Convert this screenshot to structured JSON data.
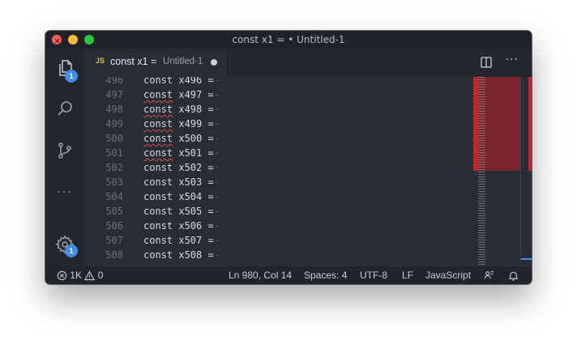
{
  "window": {
    "title": "const x1 = • Untitled-1"
  },
  "activity_bar": {
    "items": [
      {
        "icon": "files-icon",
        "badge": "1"
      },
      {
        "icon": "search-icon"
      },
      {
        "icon": "source-control-icon"
      },
      {
        "icon": "more-icon",
        "label": "···"
      },
      {
        "icon": "settings-gear-icon",
        "badge": "1"
      }
    ]
  },
  "tab": {
    "lang": "JS",
    "name": "const x1 =",
    "description": "Untitled-1",
    "dirty": true
  },
  "editor": {
    "lines": [
      {
        "number": "496",
        "code": "const x496 =",
        "error": false
      },
      {
        "number": "497",
        "code": "const x497 =",
        "error": true
      },
      {
        "number": "498",
        "code": "const x498 =",
        "error": true
      },
      {
        "number": "499",
        "code": "const x499 =",
        "error": true
      },
      {
        "number": "500",
        "code": "const x500 =",
        "error": true
      },
      {
        "number": "501",
        "code": "const x501 =",
        "error": true
      },
      {
        "number": "502",
        "code": "const x502 =",
        "error": false
      },
      {
        "number": "503",
        "code": "const x503 =",
        "error": false
      },
      {
        "number": "504",
        "code": "const x504 =",
        "error": false
      },
      {
        "number": "505",
        "code": "const x505 =",
        "error": false
      },
      {
        "number": "506",
        "code": "const x506 =",
        "error": false
      },
      {
        "number": "507",
        "code": "const x507 =",
        "error": false
      },
      {
        "number": "508",
        "code": "const x508 =",
        "error": false
      }
    ]
  },
  "status_bar": {
    "errors": "1K",
    "warnings": "0",
    "position": "Ln 980, Col 14",
    "indent": "Spaces: 4",
    "encoding": "UTF-8",
    "eol": "LF",
    "language": "JavaScript"
  },
  "colors": {
    "error": "#cc1f2d",
    "badge": "#3f8ff1",
    "js_icon": "#e3c24a"
  }
}
